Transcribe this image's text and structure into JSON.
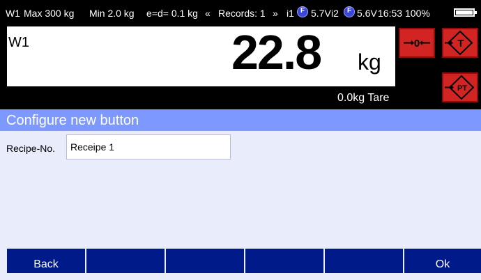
{
  "status": {
    "scale": "W1",
    "max": "Max 300 kg",
    "min": "Min 2.0 kg",
    "ed": "e=d= 0.1 kg",
    "records": "Records: 1",
    "i1": "i1",
    "i1_voltage": "5.7V",
    "i2": "i2",
    "i2_voltage": "5.6V",
    "time": "16:53",
    "battery": "100%",
    "indicator_letter": "F"
  },
  "display": {
    "scale_name": "W1",
    "weight": "22.8",
    "unit": "kg",
    "tare": "0.0kg Tare"
  },
  "side_buttons": {
    "zero": "0",
    "tare": "T",
    "preset_tare": "PT"
  },
  "dialog": {
    "title": "Configure new button",
    "recipe_label": "Recipe-No.",
    "recipe_value": "Receipe 1"
  },
  "bottom_bar": {
    "back": "Back",
    "ok": "Ok"
  },
  "colors": {
    "accent": "#7d98ff",
    "button_bar": "#001a8a",
    "side_button": "#d32424"
  }
}
